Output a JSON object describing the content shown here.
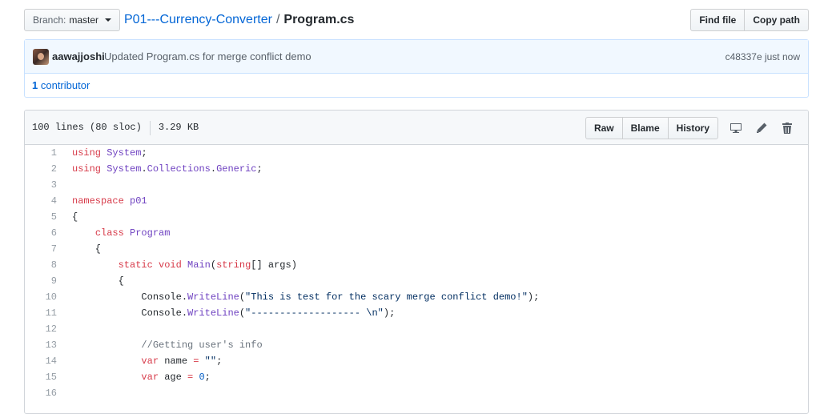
{
  "breadcrumb": {
    "branch_prefix": "Branch:",
    "branch_name": "master",
    "repo": "P01---Currency-Converter",
    "separator": "/",
    "file": "Program.cs"
  },
  "top_actions": {
    "find_file": "Find file",
    "copy_path": "Copy path"
  },
  "commit": {
    "author": "aawajjoshi",
    "message": "Updated Program.cs for merge conflict demo",
    "sha": "c48337e",
    "time": "just now",
    "contributors_count": "1",
    "contributors_label": "contributor"
  },
  "file": {
    "lines": "100 lines (80 sloc)",
    "size": "3.29 KB",
    "actions": {
      "raw": "Raw",
      "blame": "Blame",
      "history": "History"
    },
    "icons": [
      "desktop-icon",
      "pencil-icon",
      "trash-icon"
    ]
  },
  "code_lines": [
    {
      "n": "1",
      "html": "<span class=\"k\">using</span> <span class=\"e\">System</span>;"
    },
    {
      "n": "2",
      "html": "<span class=\"k\">using</span> <span class=\"e\">System</span>.<span class=\"e\">Collections</span>.<span class=\"e\">Generic</span>;"
    },
    {
      "n": "3",
      "html": ""
    },
    {
      "n": "4",
      "html": "<span class=\"k\">namespace</span> <span class=\"e\">p01</span>"
    },
    {
      "n": "5",
      "html": "{"
    },
    {
      "n": "6",
      "html": "    <span class=\"k\">class</span> <span class=\"e\">Program</span>"
    },
    {
      "n": "7",
      "html": "    {"
    },
    {
      "n": "8",
      "html": "        <span class=\"k\">static</span> <span class=\"k\">void</span> <span class=\"e\">Main</span>(<span class=\"k\">string</span>[] args)"
    },
    {
      "n": "9",
      "html": "        {"
    },
    {
      "n": "10",
      "html": "            Console.<span class=\"e\">WriteLine</span>(<span class=\"s\">\"This is test for the scary merge conflict demo!\"</span>);"
    },
    {
      "n": "11",
      "html": "            Console.<span class=\"e\">WriteLine</span>(<span class=\"s\">\"------------------- \\n\"</span>);"
    },
    {
      "n": "12",
      "html": ""
    },
    {
      "n": "13",
      "html": "            <span class=\"c\">//Getting user's info</span>"
    },
    {
      "n": "14",
      "html": "            <span class=\"k\">var</span> name <span class=\"k\">=</span> <span class=\"s\">\"\"</span>;"
    },
    {
      "n": "15",
      "html": "            <span class=\"k\">var</span> age <span class=\"k\">=</span> <span class=\"n\">0</span>;"
    },
    {
      "n": "16",
      "html": ""
    }
  ]
}
